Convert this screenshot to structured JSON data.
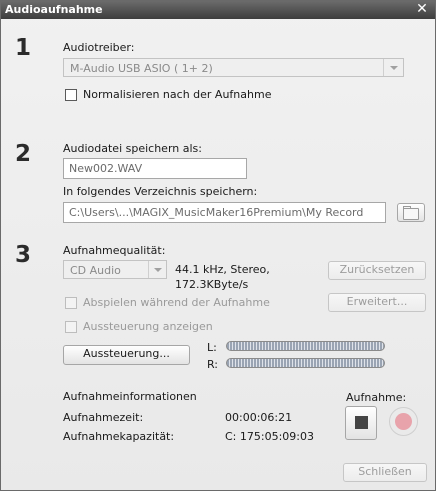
{
  "window": {
    "title": "Audioaufnahme"
  },
  "step1": {
    "number": "1",
    "driver_label": "Audiotreiber:",
    "driver_value": "M-Audio USB ASIO ( 1+ 2)",
    "normalize_label": "Normalisieren nach der Aufnahme",
    "normalize_checked": false
  },
  "step2": {
    "number": "2",
    "filename_label": "Audiodatei speichern als:",
    "filename_value": "New002.WAV",
    "folder_label": "In folgendes Verzeichnis speichern:",
    "folder_value": "C:\\Users\\...\\MAGIX_MusicMaker16Premium\\My Record"
  },
  "step3": {
    "number": "3",
    "quality_label": "Aufnahmequalität:",
    "quality_value": "CD Audio",
    "quality_info_line1": "44.1 kHz, Stereo,",
    "quality_info_line2": "172.3KByte/s",
    "reset_button": "Zurücksetzen",
    "play_during_label": "Abspielen während der Aufnahme",
    "advanced_button": "Erweitert...",
    "show_level_label": "Aussteuerung anzeigen",
    "level_button": "Aussteuerung...",
    "meter_left_label": "L:",
    "meter_right_label": "R:",
    "meter_left_level": 0.0,
    "meter_right_level": 0.0
  },
  "info": {
    "heading": "Aufnahmeinformationen",
    "time_label": "Aufnahmezeit:",
    "time_value": "00:00:06:21",
    "capacity_label": "Aufnahmekapazität:",
    "capacity_value": "C: 175:05:09:03"
  },
  "record": {
    "label": "Aufnahme:"
  },
  "footer": {
    "close_button": "Schließen"
  },
  "colors": {
    "titlebar": "#4a4a4a",
    "record_dot": "#e8a3ab",
    "meter_fill": "#445a85"
  }
}
